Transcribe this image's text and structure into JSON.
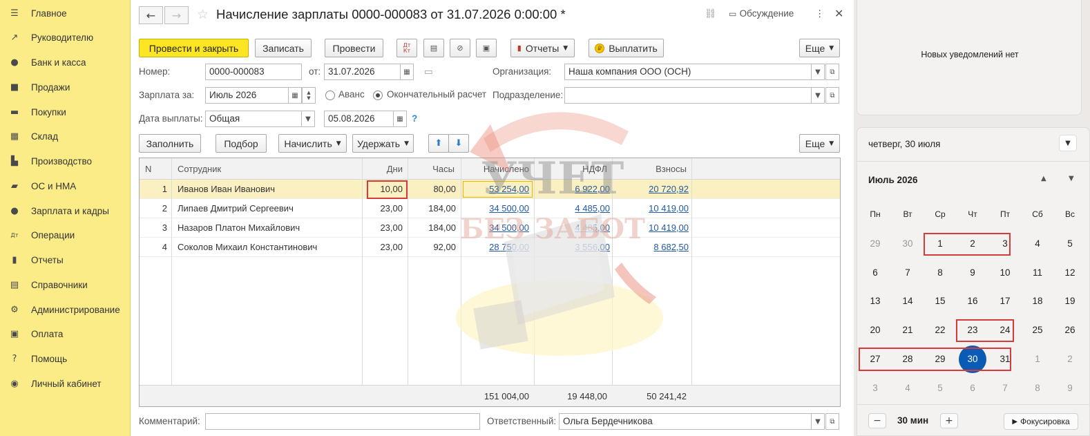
{
  "sidebar": {
    "items": [
      {
        "label": "Главное",
        "icon": "menu-icon",
        "glyph": "☰"
      },
      {
        "label": "Руководителю",
        "icon": "trend-icon",
        "glyph": "↗"
      },
      {
        "label": "Банк и касса",
        "icon": "coin-icon",
        "glyph": "●"
      },
      {
        "label": "Продажи",
        "icon": "bag-icon",
        "glyph": "■"
      },
      {
        "label": "Покупки",
        "icon": "cart-icon",
        "glyph": "▬"
      },
      {
        "label": "Склад",
        "icon": "warehouse-icon",
        "glyph": "▦"
      },
      {
        "label": "Производство",
        "icon": "factory-icon",
        "glyph": "▙"
      },
      {
        "label": "ОС и НМА",
        "icon": "truck-icon",
        "glyph": "▰"
      },
      {
        "label": "Зарплата и кадры",
        "icon": "person-icon",
        "glyph": "●"
      },
      {
        "label": "Операции",
        "icon": "dt-kt-icon",
        "glyph": "Дт"
      },
      {
        "label": "Отчеты",
        "icon": "bar-chart-icon",
        "glyph": "▮"
      },
      {
        "label": "Справочники",
        "icon": "books-icon",
        "glyph": "▤"
      },
      {
        "label": "Администрирование",
        "icon": "gear-icon",
        "glyph": "⚙"
      },
      {
        "label": "Оплата",
        "icon": "wallet-icon",
        "glyph": "▣"
      },
      {
        "label": "Помощь",
        "icon": "help-icon",
        "glyph": "?"
      },
      {
        "label": "Личный кабинет",
        "icon": "user-circle-icon",
        "glyph": "◉"
      }
    ]
  },
  "doc": {
    "title": "Начисление зарплаты 0000-000083 от 31.07.2026 0:00:00 *",
    "discussion": "Обсуждение"
  },
  "toolbar": {
    "post_close": "Провести и закрыть",
    "save": "Записать",
    "post": "Провести",
    "dt_kt": "Дт Кт",
    "reports": "Отчеты",
    "pay": "Выплатить",
    "more": "Еще"
  },
  "form": {
    "number_label": "Номер:",
    "number": "0000-000083",
    "from_label": "от:",
    "from_date": "31.07.2026",
    "org_label": "Организация:",
    "org": "Наша компания ООО (ОСН)",
    "salary_for_label": "Зарплата за:",
    "salary_for": "Июль 2026",
    "advance_label": "Аванс",
    "final_label": "Окончательный расчет",
    "dept_label": "Подразделение:",
    "dept": "",
    "pay_date_label": "Дата выплаты:",
    "pay_type": "Общая",
    "pay_date": "05.08.2026",
    "help": "?"
  },
  "table_toolbar": {
    "fill": "Заполнить",
    "select": "Подбор",
    "accrue": "Начислить",
    "withhold": "Удержать",
    "more": "Еще"
  },
  "table": {
    "headers": [
      "N",
      "Сотрудник",
      "Дни",
      "Часы",
      "Начислено",
      "НДФЛ",
      "Взносы"
    ],
    "rows": [
      [
        "1",
        "Иванов Иван Иванович",
        "10,00",
        "80,00",
        "53 254,00",
        "6 922,00",
        "20 720,92"
      ],
      [
        "2",
        "Липаев Дмитрий Сергеевич",
        "23,00",
        "184,00",
        "34 500,00",
        "4 485,00",
        "10 419,00"
      ],
      [
        "3",
        "Назаров Платон Михайлович",
        "23,00",
        "184,00",
        "34 500,00",
        "4 485,00",
        "10 419,00"
      ],
      [
        "4",
        "Соколов Михаил Константинович",
        "23,00",
        "92,00",
        "28 750,00",
        "3 556,00",
        "8 682,50"
      ]
    ],
    "totals": {
      "accrued": "151 004,00",
      "ndfl": "19 448,00",
      "contrib": "50 241,42"
    }
  },
  "footer": {
    "comment_label": "Комментарий:",
    "comment": "",
    "resp_label": "Ответственный:",
    "resp": "Ольга Бердечникова"
  },
  "watermark": {
    "line1": "УЧЕТ",
    "line2": "БЕЗ ЗАБОТ"
  },
  "notifications": {
    "text": "Новых уведомлений нет"
  },
  "calendar": {
    "date_header": "четверг, 30 июля",
    "month": "Июль 2026",
    "weekdays": [
      "Пн",
      "Вт",
      "Ср",
      "Чт",
      "Пт",
      "Сб",
      "Вс"
    ],
    "weeks": [
      [
        "29",
        "30",
        "1",
        "2",
        "3",
        "4",
        "5"
      ],
      [
        "6",
        "7",
        "8",
        "9",
        "10",
        "11",
        "12"
      ],
      [
        "13",
        "14",
        "15",
        "16",
        "17",
        "18",
        "19"
      ],
      [
        "20",
        "21",
        "22",
        "23",
        "24",
        "25",
        "26"
      ],
      [
        "27",
        "28",
        "29",
        "30",
        "31",
        "1",
        "2"
      ],
      [
        "3",
        "4",
        "5",
        "6",
        "7",
        "8",
        "9"
      ]
    ],
    "today": "30",
    "highlight_color": "#d63b3b",
    "today_color": "#0a5bb5"
  },
  "focus": {
    "minutes": "30 мин",
    "minus": "−",
    "plus": "+",
    "start": "Фокусировка"
  },
  "colors": {
    "sidebar": "#fbec88",
    "primary_button": "#fce522",
    "link": "#2259a5",
    "selected_row": "#fbf0c1"
  }
}
